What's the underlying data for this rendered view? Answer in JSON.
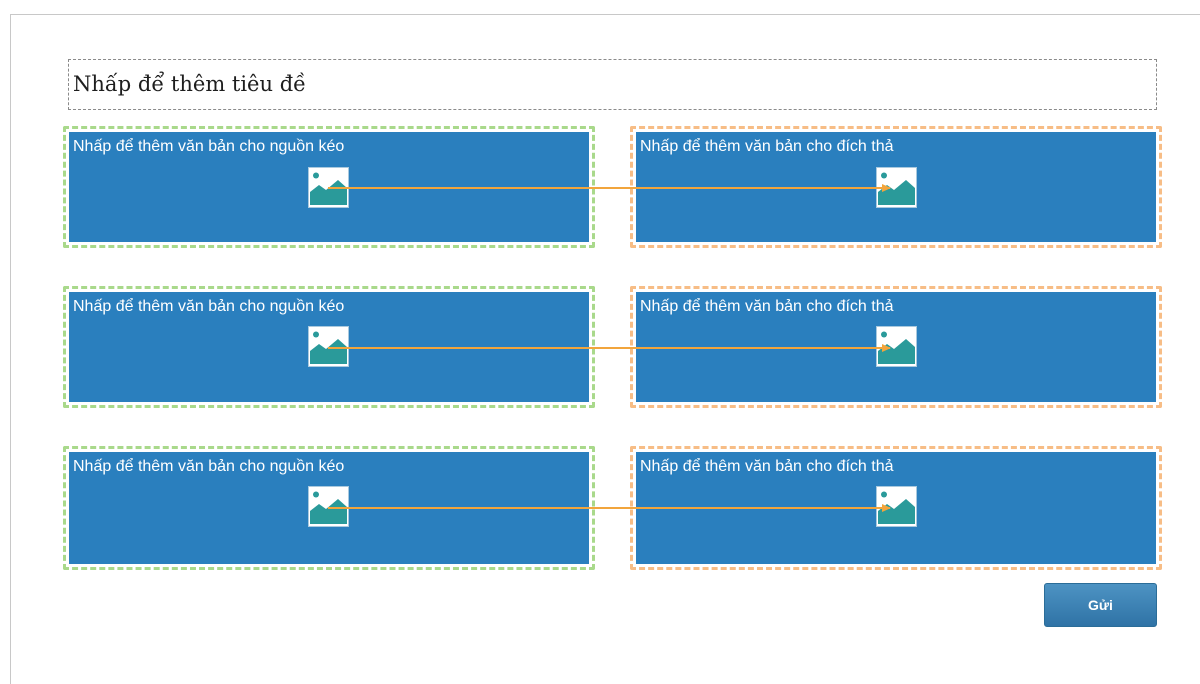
{
  "title_placeholder": "Nhấp để thêm tiêu đề",
  "rows": [
    {
      "source_text": "Nhấp để thêm văn bản cho nguồn kéo",
      "target_text": "Nhấp để thêm văn bản cho đích thả",
      "source_icon": "image-placeholder-icon",
      "target_icon": "image-placeholder-icon"
    },
    {
      "source_text": "Nhấp để thêm văn bản cho nguồn kéo",
      "target_text": "Nhấp để thêm văn bản cho đích thả",
      "source_icon": "image-placeholder-icon",
      "target_icon": "image-placeholder-icon"
    },
    {
      "source_text": "Nhấp để thêm văn bản cho nguồn kéo",
      "target_text": "Nhấp để thêm văn bản cho đích thả",
      "source_icon": "image-placeholder-icon",
      "target_icon": "image-placeholder-icon"
    }
  ],
  "submit_label": "Gửi",
  "colors": {
    "panel": "#2a7fbe",
    "source_outline": "#a9d98b",
    "target_outline": "#f7bd86",
    "connector": "#f2a53c",
    "submit": "#3a82b6"
  }
}
